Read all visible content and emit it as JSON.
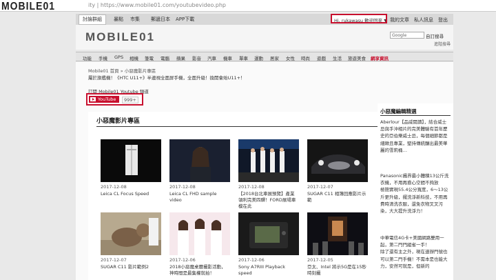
{
  "browser": {
    "url": "ity | https://www.mobile01.com/youtubevideo.php"
  },
  "top_logo": "MOBILE01",
  "topnav": {
    "tabs": [
      "討論群組",
      "暴點",
      "市集",
      "郵遞日本",
      "APP下載"
    ],
    "user": "Hi, rukawasu 歡迎回來 ▼",
    "links": [
      "我的文章",
      "私人訊息",
      "登出"
    ]
  },
  "header": {
    "logo": "MOBILE01",
    "search_placeholder": "Google",
    "search_label": "自訂搜尋",
    "advanced": "進階搜尋"
  },
  "categories": [
    "功能",
    "手機",
    "GPS",
    "相機",
    "筆電",
    "電腦",
    "蘋果",
    "影音",
    "汽車",
    "機車",
    "單車",
    "運動",
    "居家",
    "女性",
    "時尚",
    "遊戲",
    "生活",
    "旅遊美食",
    "網享資訊"
  ],
  "main": {
    "breadcrumb": "Mobile01 首頁 » 小惡魔影片專區",
    "promo": "屬於旗艦機！《HTC U11+》半邊視全面屏手機，全面升級！換開會始U11+！",
    "subscribe_title": "訂閱 Mobile01 Youtube 頻道",
    "youtube_label": "YouTube",
    "subscriber_count": "999+",
    "panel_title": "小惡魔影片專區",
    "videos": [
      {
        "date": "2017-12-08",
        "title": "Leica CL Focus Speed"
      },
      {
        "date": "2017-12-08",
        "title": "Leica CL FHD sample video"
      },
      {
        "date": "2017-12-08",
        "title": "【2018台北車展預覽】產業領利完美四驛！FORD展場車模在此"
      },
      {
        "date": "2017-12-07",
        "title": "SUGAR C11 相簿回應影片示範"
      },
      {
        "date": "2017-12-07",
        "title": "SUGAR C11 影片範例2"
      },
      {
        "date": "2017-12-06",
        "title": "2018小惡魔桌曆攝影活動，神時間是最集權就拍！"
      },
      {
        "date": "2017-12-06",
        "title": "Sony A7RIII Playback speed"
      },
      {
        "date": "2017-12-05",
        "title": "亞太、Intel 將示5G是在15秒時刻攝"
      }
    ]
  },
  "sidebar": {
    "title": "小惡魔編輯精選",
    "paragraphs": [
      "Aberlour【品威閱讀】，結合威士忌與手沖相片的完美體驗有首年歷史的亞伯樂威士忌，每個細節都是細緻且專業，堅持傳統釀出最美華麗的雪莉桶…",
      "Panasonic攝界最小體積13公斤洗衣機，不用再擔心空間不夠放\n極簡實現55.4公分寬度，6～13公斤更升級，擺洗淨新科技，不用再費時清洗衣服，還免衣物叉叉污染，大大提升洗淨力！",
      "中華電信4G卡+美國網路雙用一起，第二門門組省一手！\n除了還有主之外，現在速辦門號也可以第二門手機！不需本是也能大力，安然可就是，但新的"
    ]
  }
}
